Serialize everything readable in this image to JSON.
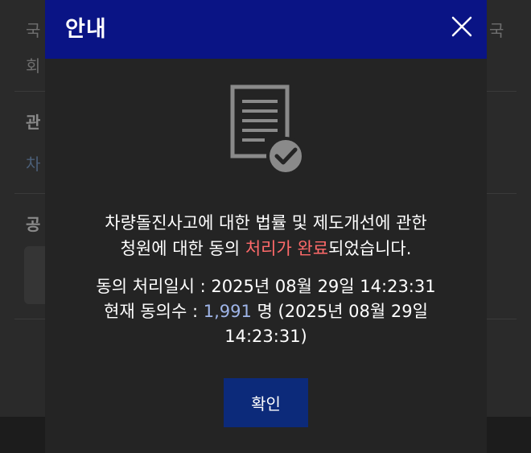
{
  "background": {
    "line1_left": "국",
    "line1_right": "국",
    "line2_left": "회",
    "section1_label": "관",
    "section1_value": "차",
    "section2_label": "공"
  },
  "modal": {
    "title": "안내",
    "close_icon": "close-icon",
    "doc_icon": "document-check-icon",
    "message": {
      "line1": "차량돌진사고에 대한 법률 및 제도개선에 관한",
      "line2_pre": "청원에 대한 동의 ",
      "line2_highlight": "처리가 완료",
      "line2_post": "되었습니다."
    },
    "details": {
      "processed_label": "동의 처리일시 : 2025년 08월 29일 14:23:31",
      "current_prefix": "현재 동의수 : ",
      "current_count": "1,991",
      "current_suffix": " 명 (2025년 08월 29일",
      "current_time": "14:23:31)"
    },
    "confirm_label": "확인"
  },
  "colors": {
    "header": "#0a1485",
    "highlight": "#ff6a6a",
    "count": "#9fb5e8",
    "button": "#0c2a7a"
  }
}
